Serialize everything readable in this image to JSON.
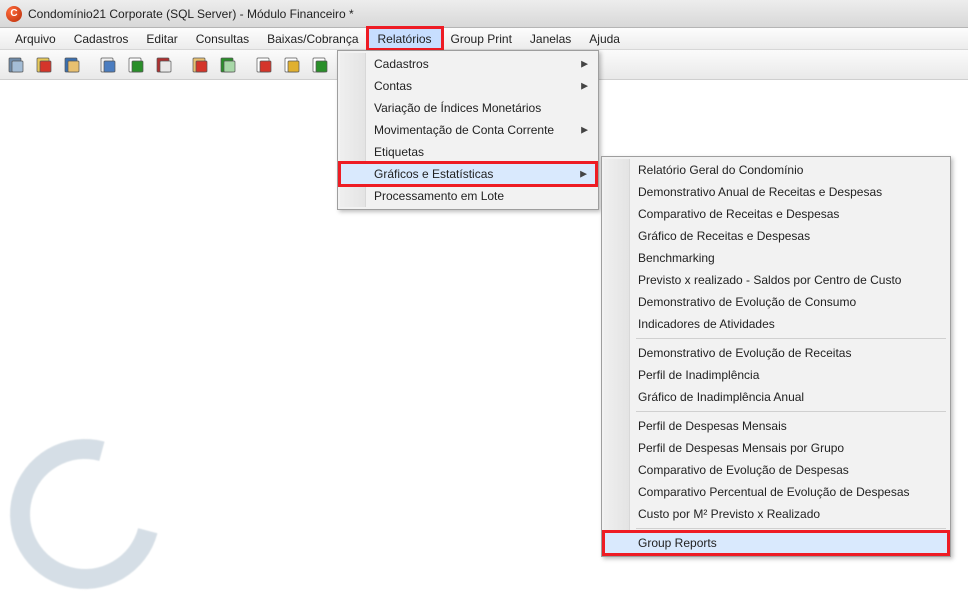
{
  "title": "Condomínio21 Corporate (SQL Server) - Módulo Financeiro *",
  "menubar": {
    "items": [
      "Arquivo",
      "Cadastros",
      "Editar",
      "Consultas",
      "Baixas/Cobrança",
      "Relatórios",
      "Group Print",
      "Janelas",
      "Ajuda"
    ],
    "active_index": 5
  },
  "toolbar_icons": [
    "buildings-icon",
    "house-icon",
    "people-icon",
    "notepad-icon",
    "dollar-doc-icon",
    "ledger-icon",
    "hand-note-icon",
    "money-stack-icon",
    "doc-red-icon",
    "doc-yellow-icon",
    "doc-green-icon"
  ],
  "dropdown1": {
    "items": [
      {
        "label": "Cadastros",
        "arrow": true
      },
      {
        "label": "Contas",
        "arrow": true
      },
      {
        "label": "Variação de Índices Monetários",
        "arrow": false
      },
      {
        "label": "Movimentação de Conta Corrente",
        "arrow": true
      },
      {
        "label": "Etiquetas",
        "arrow": false
      },
      {
        "label": "Gráficos e Estatísticas",
        "arrow": true,
        "highlight": true,
        "hover": true
      },
      {
        "label": "Processamento em Lote",
        "arrow": false
      }
    ]
  },
  "dropdown2": {
    "groups": [
      [
        {
          "label": "Relatório Geral do Condomínio"
        },
        {
          "label": "Demonstrativo Anual de Receitas e Despesas"
        },
        {
          "label": "Comparativo de Receitas e Despesas"
        },
        {
          "label": "Gráfico de Receitas e Despesas"
        },
        {
          "label": "Benchmarking"
        },
        {
          "label": "Previsto x realizado - Saldos por Centro de Custo"
        },
        {
          "label": "Demonstrativo de Evolução de Consumo"
        },
        {
          "label": "Indicadores de Atividades"
        }
      ],
      [
        {
          "label": "Demonstrativo de Evolução de Receitas"
        },
        {
          "label": "Perfil de Inadimplência"
        },
        {
          "label": "Gráfico de Inadimplência Anual"
        }
      ],
      [
        {
          "label": "Perfil de Despesas Mensais"
        },
        {
          "label": "Perfil de Despesas Mensais por Grupo"
        },
        {
          "label": "Comparativo de Evolução de Despesas"
        },
        {
          "label": "Comparativo Percentual de Evolução de Despesas"
        },
        {
          "label": "Custo por M² Previsto x Realizado"
        }
      ],
      [
        {
          "label": "Group Reports",
          "highlight": true,
          "hover": true
        }
      ]
    ]
  }
}
